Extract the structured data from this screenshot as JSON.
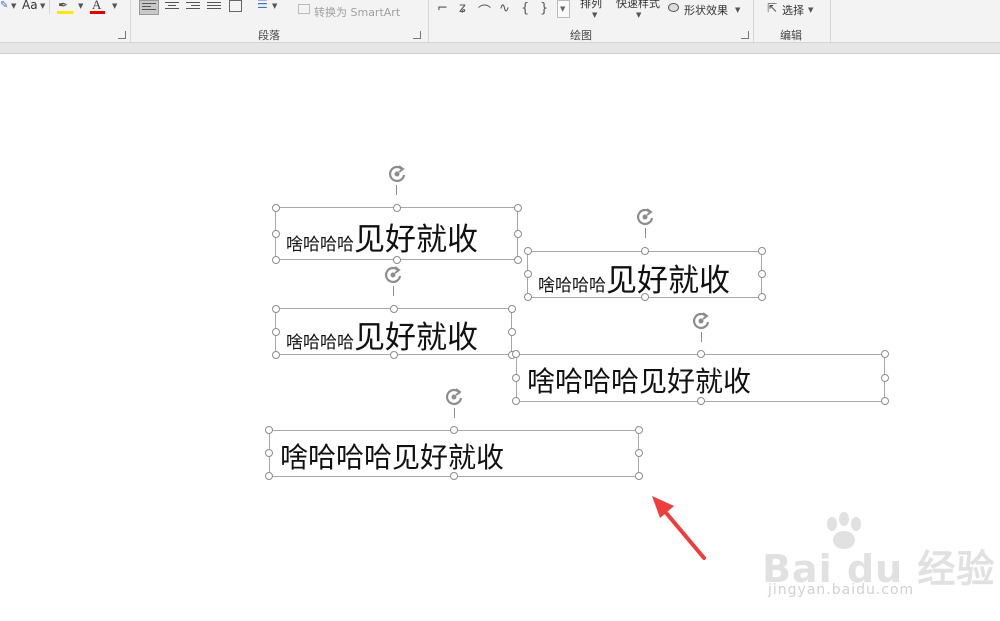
{
  "ribbon": {
    "font_size_label": "Aa",
    "convert_smartart": "转换为 SmartArt",
    "arrange": "排列",
    "quick_styles": "快速样式",
    "shape_effects": "形状效果",
    "select": "选择",
    "groups": {
      "paragraph": "段落",
      "drawing": "绘图",
      "editing": "编辑"
    },
    "colors": {
      "highlight": "#ffe600",
      "font_color": "#e00000",
      "accent": "#4472c4"
    }
  },
  "slide": {
    "textboxes": [
      {
        "small": "啥哈哈哈",
        "large": "见好就收"
      },
      {
        "small": "啥哈哈哈",
        "large": "见好就收"
      },
      {
        "small": "啥哈哈哈",
        "large": "见好就收"
      },
      {
        "text": "啥哈哈哈见好就收"
      },
      {
        "text": "啥哈哈哈见好就收"
      }
    ],
    "annotation_color": "#f03c3c"
  },
  "watermark": {
    "brand": "Bai du 经验",
    "url": "jingyan.baidu.com"
  }
}
